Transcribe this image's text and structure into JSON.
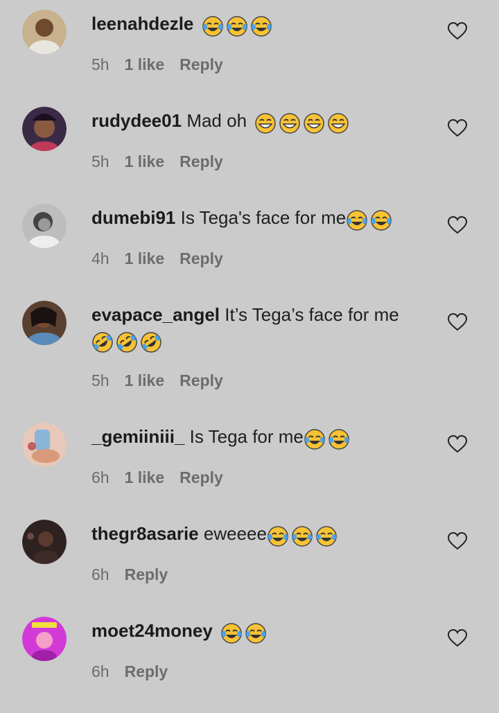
{
  "comments": [
    {
      "username": "leenahdezle",
      "text": "",
      "emojis": [
        "laugh-tears",
        "laugh-tears",
        "laugh-tears"
      ],
      "time": "5h",
      "likes": "1 like",
      "reply": "Reply",
      "avatar_color": "#c8b18d"
    },
    {
      "username": "rudydee01",
      "text": "Mad oh",
      "emojis": [
        "grin",
        "grin",
        "grin",
        "grin"
      ],
      "time": "5h",
      "likes": "1 like",
      "reply": "Reply",
      "avatar_color": "#3a2a46"
    },
    {
      "username": "dumebi91",
      "text": "Is Tega's face for me",
      "emojis": [
        "laugh-tears",
        "laugh-tears"
      ],
      "time": "4h",
      "likes": "1 like",
      "reply": "Reply",
      "avatar_color": "#8a8a8a"
    },
    {
      "username": "evapace_angel",
      "text": "It’s Tega’s face for me",
      "emojis": [
        "rofl",
        "rofl",
        "rofl"
      ],
      "time": "5h",
      "likes": "1 like",
      "reply": "Reply",
      "avatar_color": "#5a4030"
    },
    {
      "username": "_gemiiniii_",
      "text": "Is Tega for me",
      "emojis": [
        "laugh-tears",
        "laugh-tears"
      ],
      "time": "6h",
      "likes": "1 like",
      "reply": "Reply",
      "avatar_color": "#d9a78e"
    },
    {
      "username": "thegr8asarie",
      "text": "eweeee",
      "emojis": [
        "laugh-tears",
        "laugh-tears",
        "laugh-tears"
      ],
      "time": "6h",
      "likes": "",
      "reply": "Reply",
      "avatar_color": "#2e2220"
    },
    {
      "username": "moet24money",
      "text": "",
      "emojis": [
        "laugh-tears",
        "laugh-tears"
      ],
      "time": "6h",
      "likes": "",
      "reply": "Reply",
      "avatar_color": "#d23ad8"
    }
  ],
  "colors": {
    "background": "#cbcbcb",
    "emoji_face": "#f7c234",
    "emoji_tear": "#4aa3ea"
  }
}
